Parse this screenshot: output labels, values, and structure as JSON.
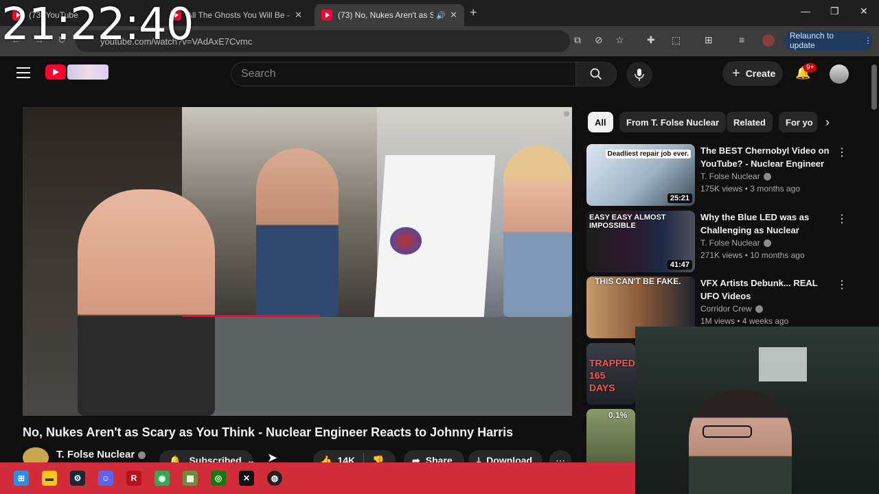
{
  "clock": "21:22:40",
  "browser": {
    "tabs": [
      {
        "title": "(73) YouTube"
      },
      {
        "title": "All The Ghosts You Will Be - Yo"
      },
      {
        "title": "(73) No, Nukes Aren't as Sc"
      }
    ],
    "url": "youtube.com/watch?v=VAdAxE7Cvmc",
    "relaunch_label": "Relaunch to update",
    "extension_badge": "3"
  },
  "youtube": {
    "search_placeholder": "Search",
    "create_label": "Create",
    "notifications_count": "9+"
  },
  "video": {
    "title": "No, Nukes Aren't as Scary as You Think - Nuclear Engineer Reacts to Johnny Harris",
    "channel": "T. Folse Nuclear",
    "subscribe_label": "Subscribed",
    "likes": "14K",
    "share_label": "Share",
    "download_label": "Download"
  },
  "chips": [
    "All",
    "From T. Folse Nuclear",
    "Related",
    "For yo"
  ],
  "recommendations": [
    {
      "title": "The BEST Chernobyl Video on YouTube? - Nuclear Engineer ...",
      "channel": "T. Folse Nuclear",
      "meta": "175K views • 3 months ago",
      "duration": "25:21",
      "thumb_text": "Deadliest repair job ever."
    },
    {
      "title": "Why the Blue LED was as Challenging as Nuclear Fusion...",
      "channel": "T. Folse Nuclear",
      "meta": "271K views • 10 months ago",
      "duration": "41:47",
      "thumb_text": "EASY   EASY   ALMOST IMPOSSIBLE"
    },
    {
      "title": "VFX Artists Debunk... REAL UFO Videos",
      "channel": "Corridor Crew",
      "meta": "1M views • 4 weeks ago",
      "duration": "",
      "thumb_text": "THIS CAN'T BE FAKE."
    },
    {
      "title": "",
      "channel": "",
      "meta": "",
      "duration": "",
      "thumb_text": "TRAPPED 165 DAYS"
    },
    {
      "title": "",
      "channel": "",
      "meta": "",
      "duration": "",
      "thumb_text": "0.1%"
    }
  ],
  "taskbar": [
    "windows-start",
    "file-explorer",
    "steam",
    "discord",
    "app-r",
    "chrome",
    "minecraft",
    "xbox-app",
    "capcut",
    "obs"
  ]
}
